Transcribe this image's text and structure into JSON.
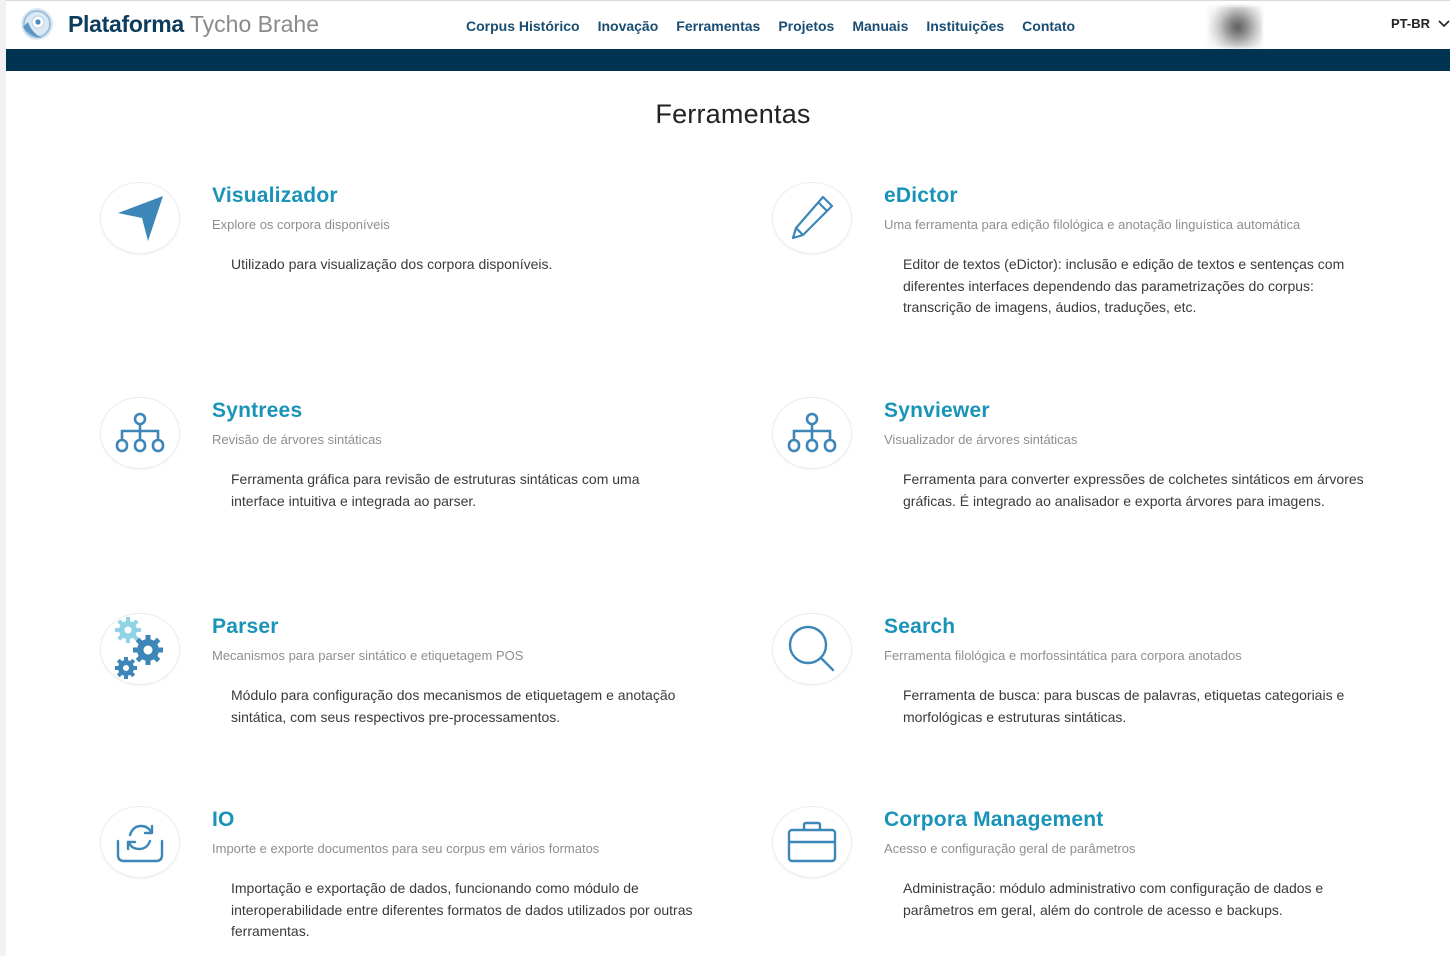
{
  "header": {
    "brand_strong": "Plataforma",
    "brand_light": "Tycho Brahe",
    "nav": [
      {
        "label": "Corpus Histórico"
      },
      {
        "label": "Inovação"
      },
      {
        "label": "Ferramentas"
      },
      {
        "label": "Projetos"
      },
      {
        "label": "Manuais"
      },
      {
        "label": "Instituições"
      },
      {
        "label": "Contato"
      }
    ],
    "language": "PT-BR"
  },
  "page": {
    "title": "Ferramentas"
  },
  "tools": [
    {
      "icon": "paper-plane-icon",
      "title": "Visualizador",
      "subtitle": "Explore os corpora disponíveis",
      "description": "Utilizado para visualização dos corpora disponíveis."
    },
    {
      "icon": "pencil-icon",
      "title": "eDictor",
      "subtitle": "Uma ferramenta para edição filológica e anotação linguística automática",
      "description": "Editor de textos (eDictor): inclusão e edição de textos e sentenças com diferentes interfaces dependendo das parametrizações do corpus: transcrição de imagens, áudios, traduções, etc."
    },
    {
      "icon": "sitemap-icon",
      "title": "Syntrees",
      "subtitle": "Revisão de árvores sintáticas",
      "description": "Ferramenta gráfica para revisão de estruturas sintáticas com uma interface intuitiva e integrada ao parser."
    },
    {
      "icon": "sitemap-icon",
      "title": "Synviewer",
      "subtitle": "Visualizador de árvores sintáticas",
      "description": "Ferramenta para converter expressões de colchetes sintáticos em árvores gráficas. É integrado ao analisador e exporta árvores para imagens."
    },
    {
      "icon": "gears-icon",
      "title": "Parser",
      "subtitle": "Mecanismos para parser sintático e etiquetagem POS",
      "description": "Módulo para configuração dos mecanismos de etiquetagem e anotação sintática, com seus respectivos pre-processamentos."
    },
    {
      "icon": "search-icon",
      "title": "Search",
      "subtitle": "Ferramenta filológica e morfossintática para corpora anotados",
      "description": "Ferramenta de busca: para buscas de palavras, etiquetas categoriais e morfológicas e estruturas sintáticas."
    },
    {
      "icon": "import-export-icon",
      "title": "IO",
      "subtitle": "Importe e exporte documentos para seu corpus em vários formatos",
      "description": "Importação e exportação de dados, funcionando como módulo de interoperabilidade entre diferentes formatos de dados utilizados por outras ferramentas."
    },
    {
      "icon": "briefcase-icon",
      "title": "Corpora Management",
      "subtitle": "Acesso e configuração geral de parâmetros",
      "description": "Administração: módulo administrativo com configuração de dados e parâmetros em geral, além do controle de acesso e backups."
    }
  ],
  "colors": {
    "brand_navy": "#0d3c5c",
    "nav_link": "#1a4d72",
    "nav_band": "#003352",
    "tool_title": "#1a93b8",
    "icon_blue": "#3d86b8",
    "gear_light": "#8fd4e6"
  }
}
